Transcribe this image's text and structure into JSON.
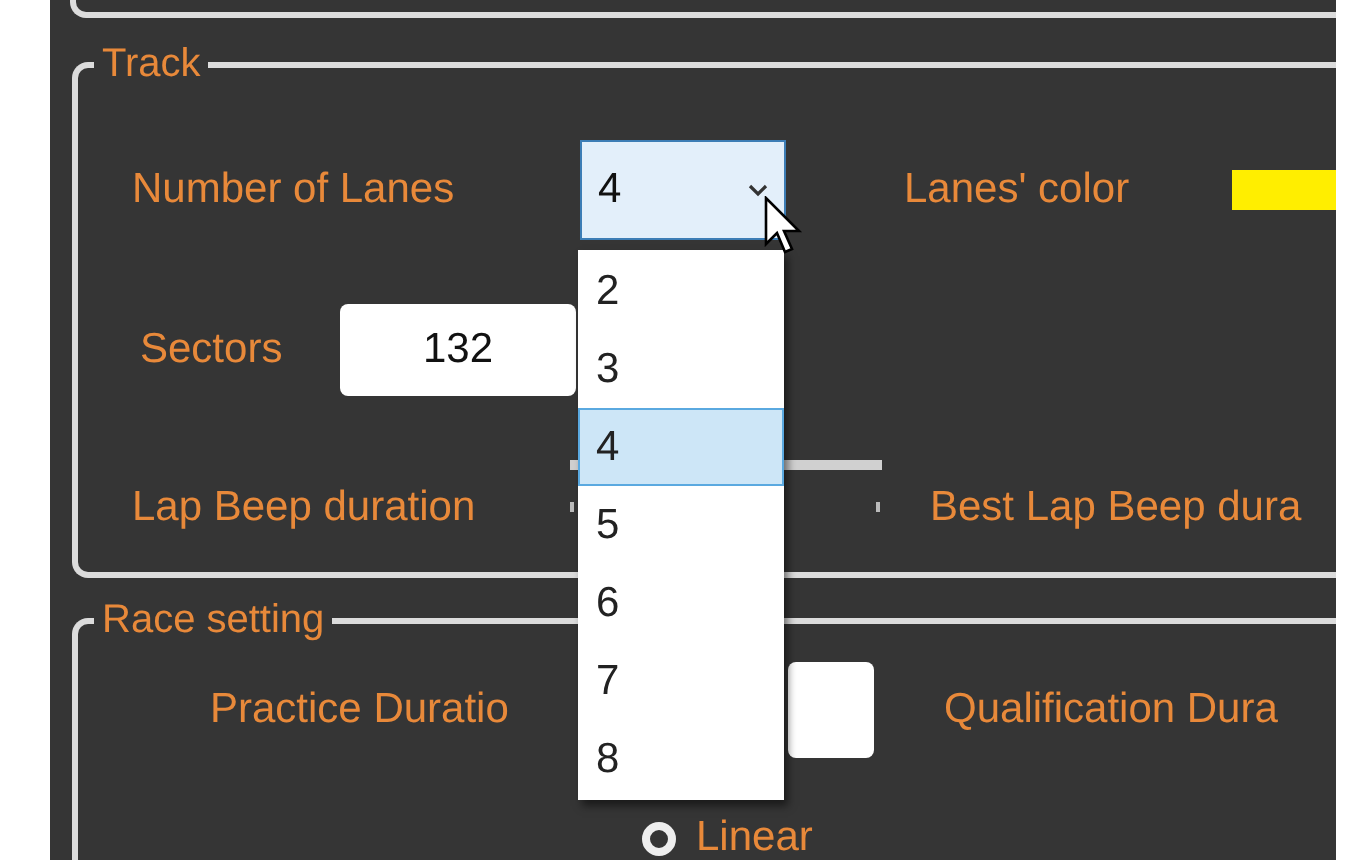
{
  "track": {
    "title": "Track",
    "lanes": {
      "label": "Number of Lanes",
      "value": "4",
      "expanded": true,
      "options": [
        {
          "label": "2",
          "selected": false
        },
        {
          "label": "3",
          "selected": false
        },
        {
          "label": "4",
          "selected": true
        },
        {
          "label": "5",
          "selected": false
        },
        {
          "label": "6",
          "selected": false
        },
        {
          "label": "7",
          "selected": false
        },
        {
          "label": "8",
          "selected": false
        }
      ]
    },
    "lanes_color": {
      "label": "Lanes' color",
      "color": "#ffee00"
    },
    "sectors": {
      "label": "Sectors",
      "value": "132"
    },
    "lap_beep": {
      "label": "Lap Beep duration"
    },
    "best_lap_beep": {
      "label": "Best Lap Beep dura"
    }
  },
  "race_setting": {
    "title": "Race setting",
    "practice_duration": {
      "label": "Practice Duratio"
    },
    "qualification_duration": {
      "label": "Qualification Dura"
    },
    "mode_options": [
      {
        "label": "Linear",
        "selected": false
      }
    ]
  }
}
